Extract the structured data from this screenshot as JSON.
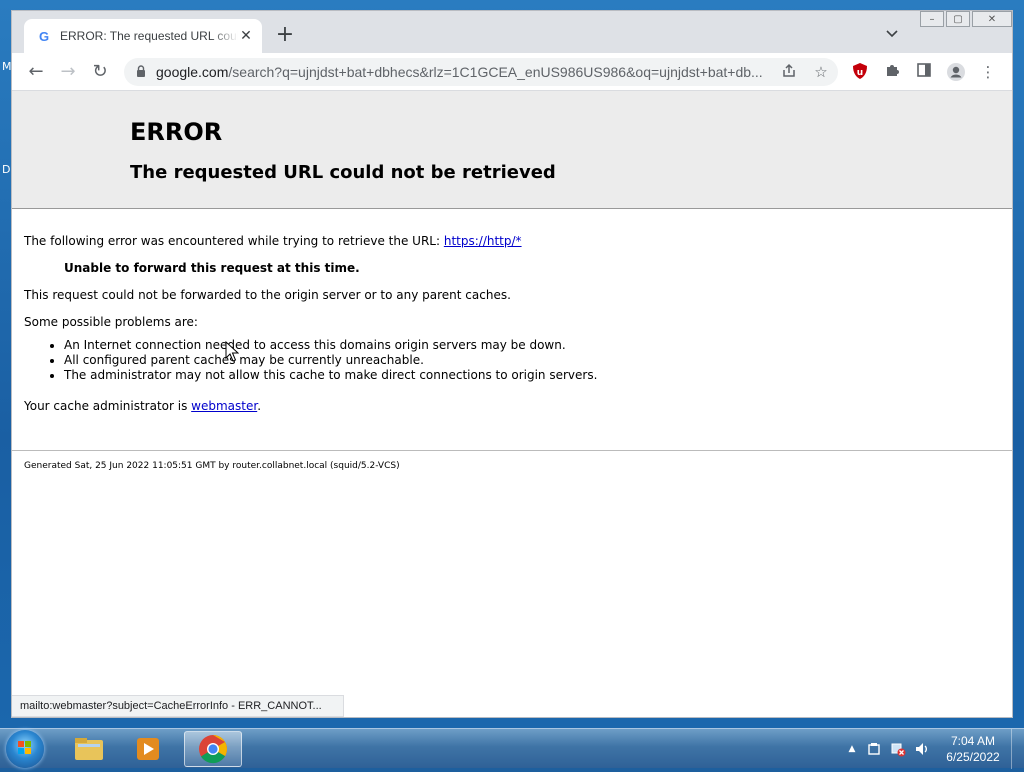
{
  "desktop": {
    "left_letters": [
      "M",
      "D"
    ]
  },
  "browser": {
    "tab": {
      "title": "ERROR: The requested URL could not be retrieved",
      "favicon": "G"
    },
    "new_tab_symbol": "+",
    "tab_list_symbol": "⌄",
    "window_controls": {
      "minimize": "–",
      "maximize": "▢",
      "close": "✕"
    },
    "nav": {
      "back": "←",
      "forward": "→",
      "reload": "↻"
    },
    "omnibox": {
      "host": "google.com",
      "path": "/search?q=ujnjdst+bat+dbhecs&rlz=1C1GCEA_enUS986US986&oq=ujnjdst+bat+db..."
    },
    "status_bar": "mailto:webmaster?subject=CacheErrorInfo - ERR_CANNOT..."
  },
  "page": {
    "h1": "ERROR",
    "h2": "The requested URL could not be retrieved",
    "intro_text": "The following error was encountered while trying to retrieve the URL:",
    "intro_link": "https://http/*",
    "reason": "Unable to forward this request at this time.",
    "description": "This request could not be forwarded to the origin server or to any parent caches.",
    "problems_heading": "Some possible problems are:",
    "problems": [
      "An Internet connection needed to access this domains origin servers may be down.",
      "All configured parent caches may be currently unreachable.",
      "The administrator may not allow this cache to make direct connections to origin servers."
    ],
    "admin_text": "Your cache administrator is",
    "admin_link": "webmaster",
    "admin_period": ".",
    "footer": "Generated Sat, 25 Jun 2022 11:05:51 GMT by router.collabnet.local (squid/5.2-VCS)"
  },
  "taskbar": {
    "clock_time": "7:04 AM",
    "clock_date": "6/25/2022",
    "tray_up_arrow": "▲"
  }
}
